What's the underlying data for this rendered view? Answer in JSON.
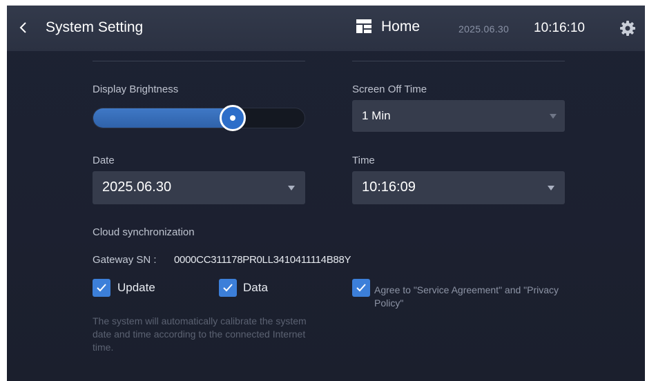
{
  "header": {
    "back_icon": "chevron-left-icon",
    "title": "System Setting",
    "home_icon": "home-layout-icon",
    "home_label": "Home",
    "date": "2025.06.30",
    "time": "10:16:10",
    "settings_icon": "gear-icon"
  },
  "brightness": {
    "label": "Display Brightness",
    "level_percent": 66
  },
  "screen_off": {
    "label": "Screen Off Time",
    "value": "1 Min"
  },
  "date_field": {
    "label": "Date",
    "value": "2025.06.30"
  },
  "time_field": {
    "label": "Time",
    "value": "10:16:09"
  },
  "cloud": {
    "title": "Cloud synchronization",
    "gateway_label": "Gateway SN :",
    "gateway_sn": "0000CC311178PR0LL3410411114B88Y",
    "options": [
      {
        "label": "Update",
        "checked": true
      },
      {
        "label": "Data",
        "checked": true
      }
    ],
    "agree": {
      "checked": true,
      "text": "Agree to \"Service Agreement\" and \"Privacy Policy\""
    },
    "hint": "The system will automatically calibrate the system date and time according to the connected Internet time."
  },
  "colors": {
    "accent": "#3c7fd9",
    "background": "#1d2232",
    "header": "#2f3546"
  }
}
